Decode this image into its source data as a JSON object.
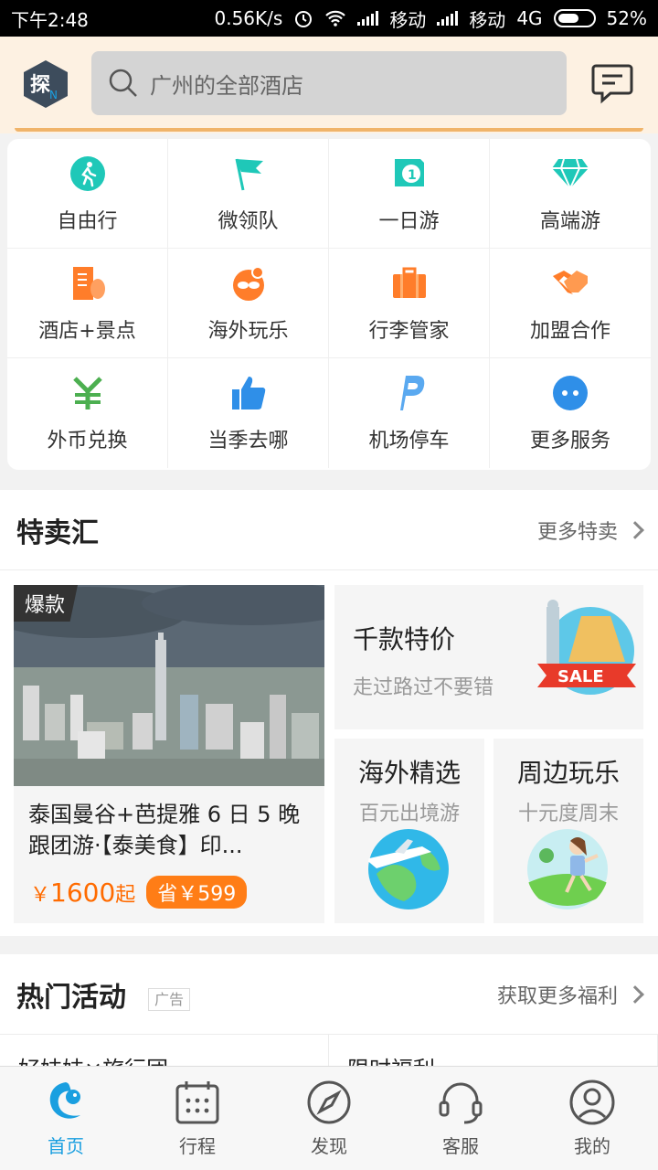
{
  "status_bar": {
    "time": "下午2:48",
    "speed": "0.56K/s",
    "carrier1": "移动",
    "carrier2": "移动",
    "network": "4G",
    "battery": "52%"
  },
  "header": {
    "search_placeholder": "广州的全部酒店",
    "logo_icon": "ctrip-logo",
    "message_icon": "message-icon"
  },
  "services": [
    {
      "label": "自由行",
      "icon": "walker-icon",
      "color": "#1fc8b8"
    },
    {
      "label": "微领队",
      "icon": "flag-icon",
      "color": "#1fc8b8"
    },
    {
      "label": "一日游",
      "icon": "one-day-icon",
      "color": "#1fc8b8"
    },
    {
      "label": "高端游",
      "icon": "diamond-icon",
      "color": "#1fc8b8"
    },
    {
      "label": "酒店+景点",
      "icon": "hotel-icon",
      "color": "#ff7d2a"
    },
    {
      "label": "海外玩乐",
      "icon": "sunglasses-icon",
      "color": "#ff7d2a"
    },
    {
      "label": "行李管家",
      "icon": "luggage-icon",
      "color": "#ff7d2a"
    },
    {
      "label": "加盟合作",
      "icon": "handshake-icon",
      "color": "#ff7d2a"
    },
    {
      "label": "外币兑换",
      "icon": "yuan-icon",
      "color": "#4caf50"
    },
    {
      "label": "当季去哪",
      "icon": "thumb-up-icon",
      "color": "#2f8fe8"
    },
    {
      "label": "机场停车",
      "icon": "parking-icon",
      "color": "#2f8fe8"
    },
    {
      "label": "更多服务",
      "icon": "more-icon",
      "color": "#2f8fe8"
    }
  ],
  "sale": {
    "title": "特卖汇",
    "more": "更多特卖",
    "deal": {
      "tag": "爆款",
      "title": "泰国曼谷+芭提雅 6 日 5 晚跟团游·【泰美食】印...",
      "price_symbol": "￥",
      "price": "1600",
      "price_suffix": "起",
      "save": "省￥599"
    },
    "promo_big": {
      "title": "千款特价",
      "subtitle": "走过路过不要错",
      "badge": "SALE"
    },
    "promo_left": {
      "title": "海外精选",
      "subtitle": "百元出境游"
    },
    "promo_right": {
      "title": "周边玩乐",
      "subtitle": "十元度周末"
    }
  },
  "hot": {
    "title": "热门活动",
    "ad": "广告",
    "more": "获取更多福利",
    "items": [
      "好妹妹×旅行团",
      "限时福利"
    ]
  },
  "tabs": [
    {
      "label": "首页",
      "icon": "dolphin-icon",
      "active": true
    },
    {
      "label": "行程",
      "icon": "calendar-icon",
      "active": false
    },
    {
      "label": "发现",
      "icon": "compass-icon",
      "active": false
    },
    {
      "label": "客服",
      "icon": "headset-icon",
      "active": false
    },
    {
      "label": "我的",
      "icon": "profile-icon",
      "active": false
    }
  ]
}
